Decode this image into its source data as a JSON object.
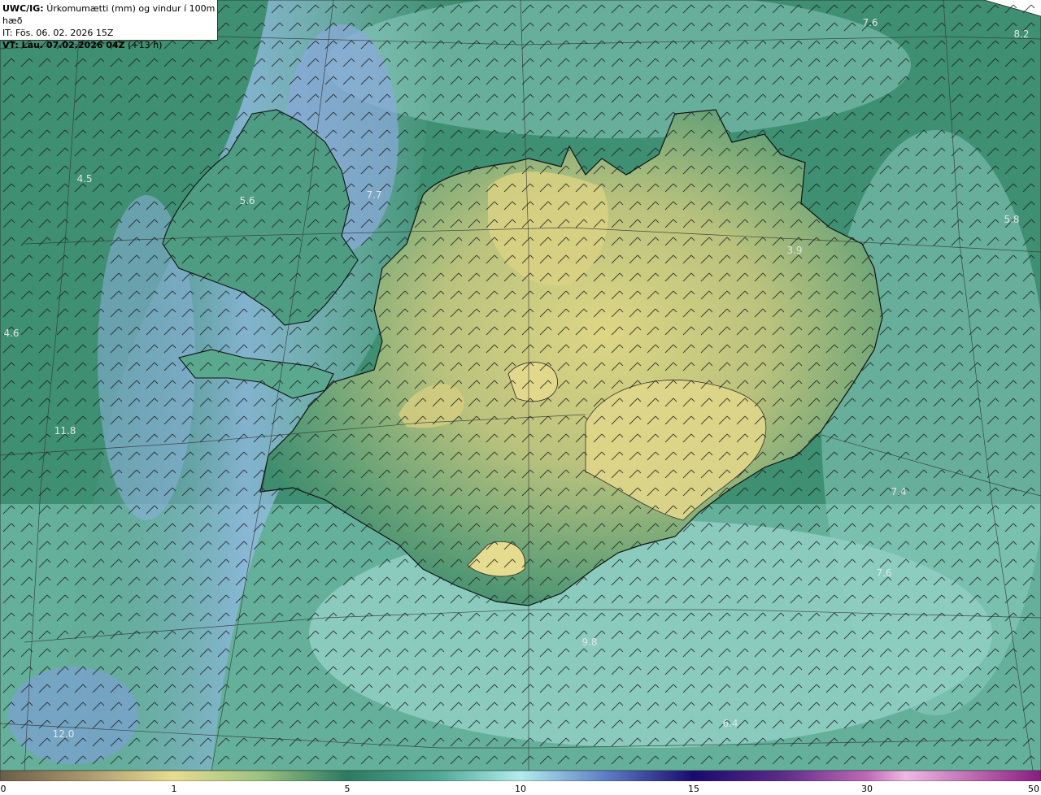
{
  "header": {
    "title_bold": "UWC/IG:",
    "title_rest": "Úrkomumætti (mm) og vindur í 100m hæð",
    "issue_time": "IT: Fös. 06. 02. 2026 15Z",
    "valid_bold": "VT: Lau. 07.02.2026 04Z",
    "valid_rest": "(+13 h)"
  },
  "value_labels": [
    "7.6",
    "8.2",
    "4.5",
    "5.6",
    "7.7",
    "5.8",
    "3.9",
    "4.6",
    "11.8",
    "12.0",
    "6.4",
    "7.4",
    "7.6",
    "9.8"
  ],
  "colorbar": {
    "ticks": [
      "0",
      "1",
      "5",
      "10",
      "15",
      "30",
      "50"
    ],
    "colors": [
      "#7c6a4e",
      "#b7a77a",
      "#e9dc8c",
      "#a8c47e",
      "#4e9a6e",
      "#2e7a60",
      "#5fb3a2",
      "#b6ecec",
      "#6a8fd0",
      "#3a3aa0",
      "#1a0a70",
      "#6a1a8a",
      "#d070c0",
      "#f0b0e0",
      "#c050b0",
      "#8a1a80"
    ]
  },
  "colors": {
    "ocean_deep": "#2f7a62",
    "ocean_mid": "#4d9d82",
    "ocean_light": "#9ed8d1",
    "blue_band": "#7ea9d9",
    "land_dry": "#d6cf80",
    "land_mid": "#82b07c",
    "coast": "#111111"
  }
}
